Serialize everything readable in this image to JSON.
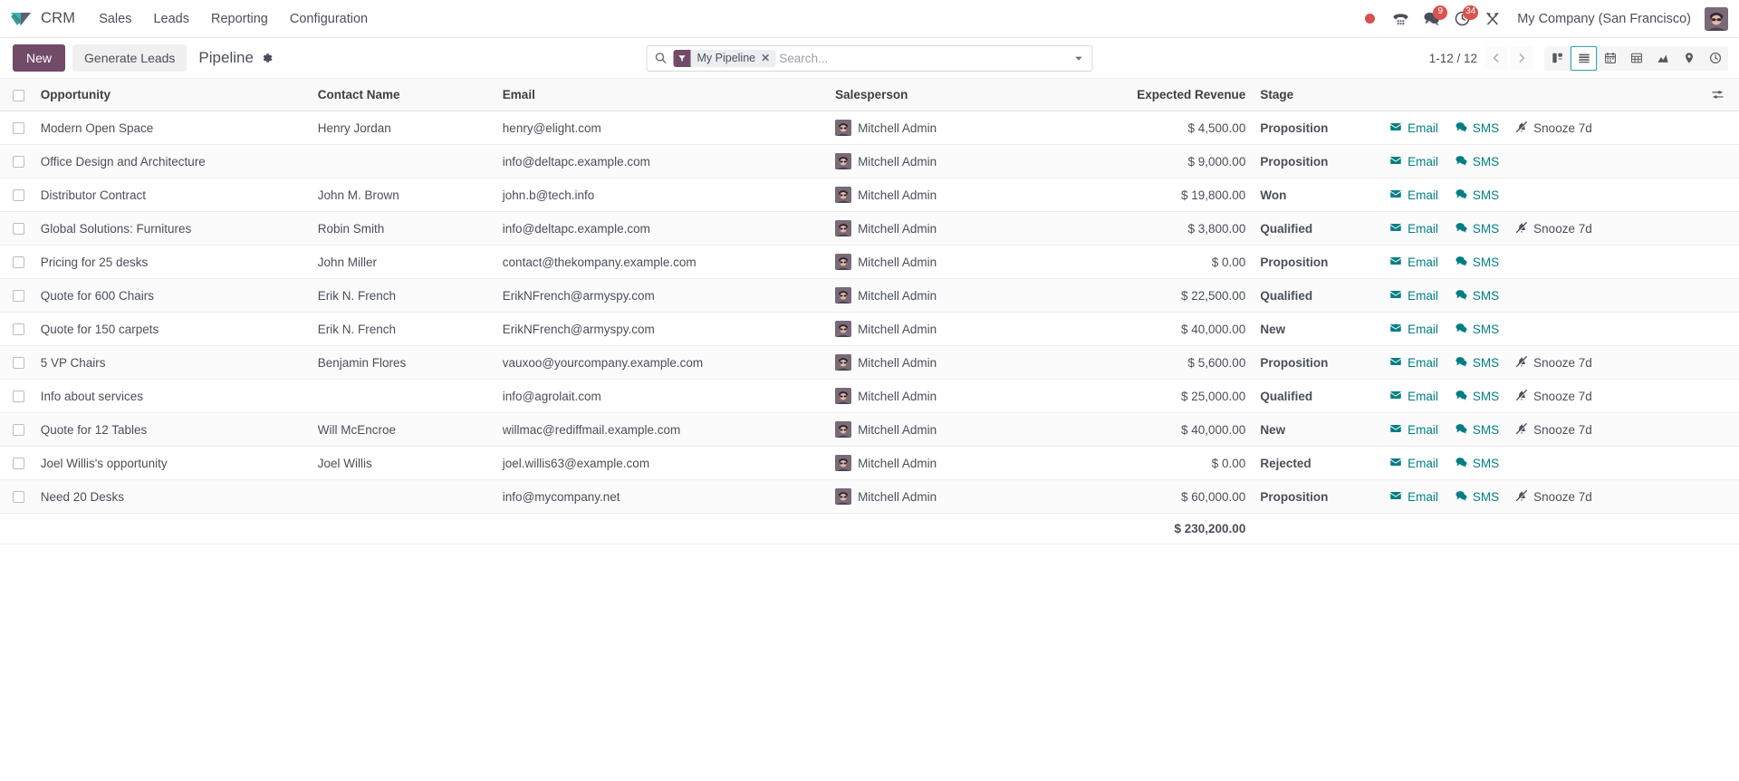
{
  "navbar": {
    "brand": "CRM",
    "brand_logo_icon": "odoo-crm-logo-icon",
    "menu": [
      {
        "label": "Sales"
      },
      {
        "label": "Leads"
      },
      {
        "label": "Reporting"
      },
      {
        "label": "Configuration"
      }
    ],
    "systray": {
      "recording_icon": "recording-dot-icon",
      "voip_icon": "phone-dialpad-icon",
      "messaging_icon": "messaging-bubble-icon",
      "messaging_count": "9",
      "activities_icon": "clock-activities-icon",
      "activities_count": "34",
      "apps_icon": "tools-icon",
      "company": "My Company (San Francisco)",
      "avatar_icon": "user-avatar"
    }
  },
  "control_panel": {
    "new_label": "New",
    "generate_leads_label": "Generate Leads",
    "breadcrumb": "Pipeline",
    "settings_icon": "gear-icon",
    "search": {
      "search_icon": "search-icon",
      "facet_icon": "filter-funnel-icon",
      "facet_label": "My Pipeline",
      "facet_remove_icon": "close-icon",
      "value": "",
      "placeholder": "Search...",
      "dropdown_icon": "chevron-down-icon"
    },
    "pager": {
      "text": "1-12 / 12",
      "prev_icon": "chevron-left-icon",
      "next_icon": "chevron-right-icon"
    },
    "views": [
      {
        "name": "kanban",
        "icon": "kanban-icon",
        "active": false
      },
      {
        "name": "list",
        "icon": "list-icon",
        "active": true
      },
      {
        "name": "calendar",
        "icon": "calendar-icon",
        "active": false
      },
      {
        "name": "pivot",
        "icon": "pivot-table-icon",
        "active": false
      },
      {
        "name": "graph",
        "icon": "graph-area-icon",
        "active": false
      },
      {
        "name": "map",
        "icon": "map-pin-icon",
        "active": false
      },
      {
        "name": "activity",
        "icon": "clock-icon",
        "active": false
      }
    ]
  },
  "list": {
    "columns": {
      "opportunity": "Opportunity",
      "contact_name": "Contact Name",
      "email": "Email",
      "salesperson": "Salesperson",
      "expected_revenue": "Expected Revenue",
      "stage": "Stage"
    },
    "optional_columns_icon": "sliders-icon",
    "select_all_checkbox": "checkbox",
    "email_action_label": "Email",
    "email_action_icon": "envelope-icon",
    "sms_action_label": "SMS",
    "sms_action_icon": "comment-icon",
    "snooze_action_label": "Snooze 7d",
    "snooze_action_icon": "bell-slash-icon",
    "rows": [
      {
        "opportunity": "Modern Open Space",
        "contact": "Henry Jordan",
        "email": "henry@elight.com",
        "salesperson": "Mitchell Admin",
        "revenue": "$ 4,500.00",
        "stage": "Proposition",
        "snooze": true
      },
      {
        "opportunity": "Office Design and Architecture",
        "contact": "",
        "email": "info@deltapc.example.com",
        "salesperson": "Mitchell Admin",
        "revenue": "$ 9,000.00",
        "stage": "Proposition",
        "snooze": false
      },
      {
        "opportunity": "Distributor Contract",
        "contact": "John M. Brown",
        "email": "john.b@tech.info",
        "salesperson": "Mitchell Admin",
        "revenue": "$ 19,800.00",
        "stage": "Won",
        "snooze": false
      },
      {
        "opportunity": "Global Solutions: Furnitures",
        "contact": "Robin Smith",
        "email": "info@deltapc.example.com",
        "salesperson": "Mitchell Admin",
        "revenue": "$ 3,800.00",
        "stage": "Qualified",
        "snooze": true
      },
      {
        "opportunity": "Pricing for 25 desks",
        "contact": "John Miller",
        "email": "contact@thekompany.example.com",
        "salesperson": "Mitchell Admin",
        "revenue": "$ 0.00",
        "stage": "Proposition",
        "snooze": false
      },
      {
        "opportunity": "Quote for 600 Chairs",
        "contact": "Erik N. French",
        "email": "ErikNFrench@armyspy.com",
        "salesperson": "Mitchell Admin",
        "revenue": "$ 22,500.00",
        "stage": "Qualified",
        "snooze": false
      },
      {
        "opportunity": "Quote for 150 carpets",
        "contact": "Erik N. French",
        "email": "ErikNFrench@armyspy.com",
        "salesperson": "Mitchell Admin",
        "revenue": "$ 40,000.00",
        "stage": "New",
        "snooze": false
      },
      {
        "opportunity": "5 VP Chairs",
        "contact": "Benjamin Flores",
        "email": "vauxoo@yourcompany.example.com",
        "salesperson": "Mitchell Admin",
        "revenue": "$ 5,600.00",
        "stage": "Proposition",
        "snooze": true
      },
      {
        "opportunity": "Info about services",
        "contact": "",
        "email": "info@agrolait.com",
        "salesperson": "Mitchell Admin",
        "revenue": "$ 25,000.00",
        "stage": "Qualified",
        "snooze": true
      },
      {
        "opportunity": "Quote for 12 Tables",
        "contact": "Will McEncroe",
        "email": "willmac@rediffmail.example.com",
        "salesperson": "Mitchell Admin",
        "revenue": "$ 40,000.00",
        "stage": "New",
        "snooze": true
      },
      {
        "opportunity": "Joel Willis's opportunity",
        "contact": "Joel Willis",
        "email": "joel.willis63@example.com",
        "salesperson": "Mitchell Admin",
        "revenue": "$ 0.00",
        "stage": "Rejected",
        "snooze": false
      },
      {
        "opportunity": "Need 20 Desks",
        "contact": "",
        "email": "info@mycompany.net",
        "salesperson": "Mitchell Admin",
        "revenue": "$ 60,000.00",
        "stage": "Proposition",
        "snooze": true
      }
    ],
    "total_revenue": "$ 230,200.00"
  },
  "colors": {
    "primary": "#714b67",
    "link": "#017e84",
    "accent_active": "#3aa4ae",
    "badge_red": "#d9534f"
  }
}
